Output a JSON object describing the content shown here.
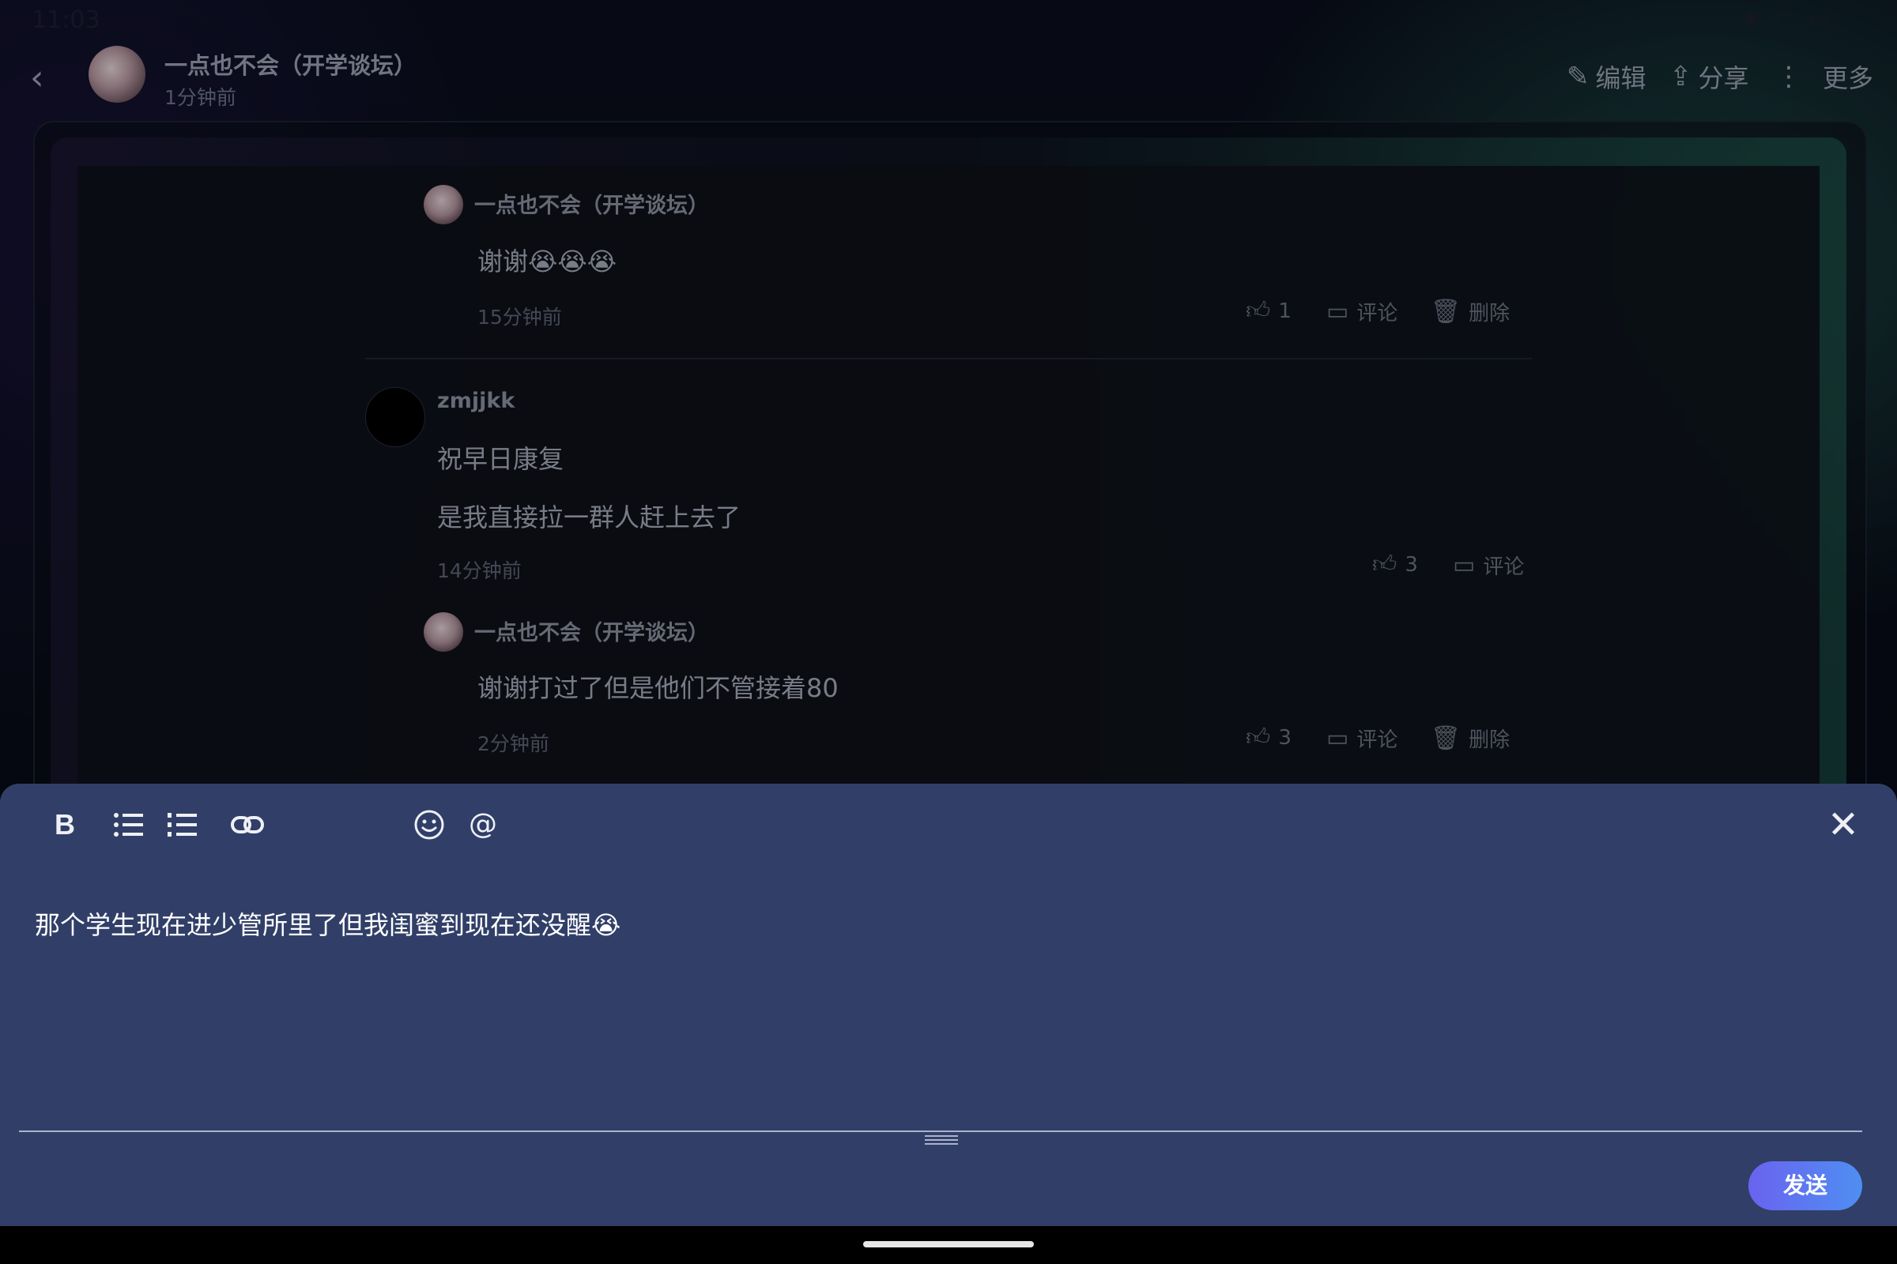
{
  "status_bar": {
    "time": "11:03",
    "icons": "✱ ◠ ▭"
  },
  "header": {
    "author": "一点也不会（开学谈坛）",
    "time": "1分钟前",
    "actions": {
      "edit": "编辑",
      "share": "分享",
      "more": "更多"
    }
  },
  "comments": [
    {
      "name": "一点也不会（开学谈坛）",
      "text": "谢谢😭😭😭",
      "time": "15分钟前",
      "likes": "1",
      "reply": "评论",
      "delete": "删除"
    },
    {
      "name": "zmjjkk",
      "text1": "祝早日康复",
      "text2": "是我直接拉一群人赶上去了",
      "time": "14分钟前",
      "likes": "3",
      "reply": "评论"
    },
    {
      "name": "一点也不会（开学谈坛）",
      "text": "谢谢打过了但是他们不管接着80",
      "time": "2分钟前",
      "likes": "3",
      "reply": "评论",
      "delete": "删除"
    }
  ],
  "composer": {
    "text": "那个学生现在进少管所里了但我闺蜜到现在还没醒😭",
    "send": "发送",
    "toolbar": {
      "bold": "B"
    }
  },
  "icons": {
    "back": "chevron-left",
    "edit": "pencil",
    "share": "share",
    "more": "vertical-dots",
    "like": "thumbs-up",
    "reply": "speech-bubble",
    "delete": "trash",
    "bullet_list": "bullet-list",
    "numbered_list": "numbered-list",
    "link": "link",
    "emoji": "smiley",
    "mention": "at-sign",
    "close": "x"
  }
}
